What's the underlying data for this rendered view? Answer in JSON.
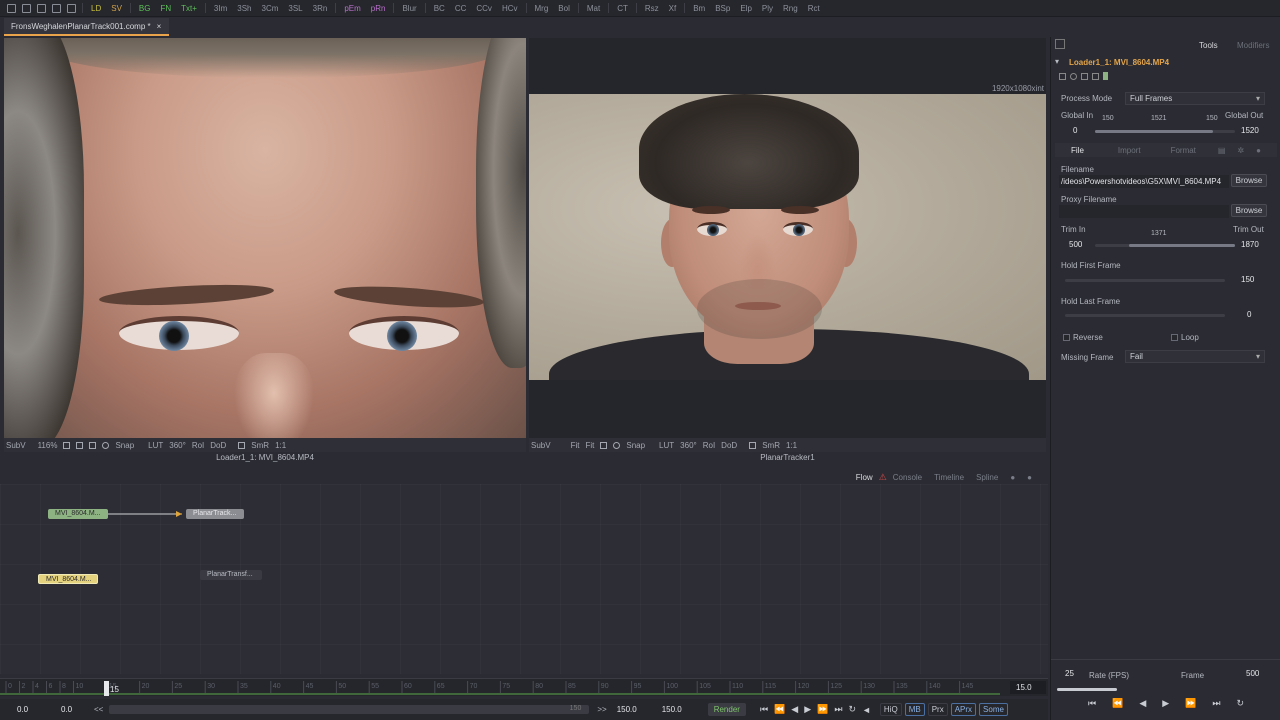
{
  "toolbar": {
    "buttons": [
      "LD",
      "SV",
      "BG",
      "FN",
      "Txt+",
      "3Im",
      "3Sh",
      "3Cm",
      "3SL",
      "3Rn",
      "pEm",
      "pRn",
      "Blur",
      "BC",
      "CC",
      "CCv",
      "HCv",
      "Mrg",
      "Bol",
      "Mat",
      "CT",
      "Rsz",
      "Xf",
      "Bm",
      "BSp",
      "Elp",
      "Ply",
      "Rng",
      "Rct"
    ]
  },
  "tab": {
    "title": "FronsWeghalenPlanarTrack001.comp *",
    "close": "×"
  },
  "viewer_left": {
    "tools": [
      "SubV",
      "116%",
      "Snap",
      "LUT",
      "360°",
      "RoI",
      "DoD",
      "SmR",
      "1:1"
    ],
    "label": "Loader1_1: MVI_8604.MP4"
  },
  "viewer_right": {
    "resolution": "1920x1080xint",
    "tools": [
      "SubV",
      "Fit",
      "Fit",
      "Snap",
      "LUT",
      "360°",
      "RoI",
      "DoD",
      "SmR",
      "1:1"
    ],
    "label": "PlanarTracker1"
  },
  "flow_tabs": [
    "Flow",
    "Console",
    "Timeline",
    "Spline"
  ],
  "nodes": {
    "loader_a": "MVI_8604.M...",
    "planar_tracker": "PlanarTrack...",
    "loader_b": "MVI_8604.M...",
    "planar_transform": "PlanarTransf..."
  },
  "ruler": {
    "ticks": [
      "0",
      "2",
      "4",
      "6",
      "8",
      "10",
      "15",
      "20",
      "25",
      "30",
      "35",
      "40",
      "45",
      "50",
      "55",
      "60",
      "65",
      "70",
      "75",
      "80",
      "85",
      "90",
      "95",
      "100",
      "105",
      "110",
      "115",
      "120",
      "125",
      "130",
      "135",
      "140",
      "145"
    ],
    "current_frame": "15",
    "end_field": "15.0"
  },
  "transport": {
    "global_start": "0.0",
    "render_start": "0.0",
    "nav_left": "<<",
    "range_end_label": "150",
    "nav_right": ">>",
    "render_end": "150.0",
    "global_end": "150.0",
    "render_btn": "Render",
    "buttons": [
      "HiQ",
      "MB",
      "Prx",
      "APrx",
      "Some"
    ]
  },
  "panel": {
    "tabs": [
      "Tools",
      "Modifiers"
    ],
    "node_title": "Loader1_1: MVI_8604.MP4",
    "process_mode_label": "Process Mode",
    "process_mode_value": "Full Frames",
    "global_in_label": "Global In",
    "global_out_label": "Global Out",
    "global_in_value": "0",
    "global_out_value": "1520",
    "global_mid_left": "150",
    "global_mid": "1521",
    "global_mid_right": "150",
    "global_range_fraction": [
      0.0,
      0.84
    ],
    "subtabs": [
      "File",
      "Import",
      "Format"
    ],
    "filename_label": "Filename",
    "filename_value": "/ideos\\Powershotvideos\\G5X\\MVI_8604.MP4",
    "browse": "Browse",
    "proxy_label": "Proxy Filename",
    "proxy_value": "",
    "trim_in_label": "Trim In",
    "trim_out_label": "Trim Out",
    "trim_in_value": "500",
    "trim_out_value": "1870",
    "trim_mid": "1371",
    "hold_first_label": "Hold First Frame",
    "hold_first_value": "150",
    "hold_last_label": "Hold Last Frame",
    "hold_last_value": "0",
    "reverse_label": "Reverse",
    "loop_label": "Loop",
    "missing_frame_label": "Missing Frame",
    "missing_frame_value": "Fail"
  },
  "playback": {
    "step": "25",
    "rate_label": "Rate (FPS)",
    "frame_label": "Frame",
    "frame_value": "500"
  },
  "colors": {
    "accent_orange": "#e9a44b",
    "loader_node": "#8db383",
    "tracker_node": "#8c8d93",
    "loader_b_node": "#e5d27e",
    "render_green": "#7fc56b"
  }
}
